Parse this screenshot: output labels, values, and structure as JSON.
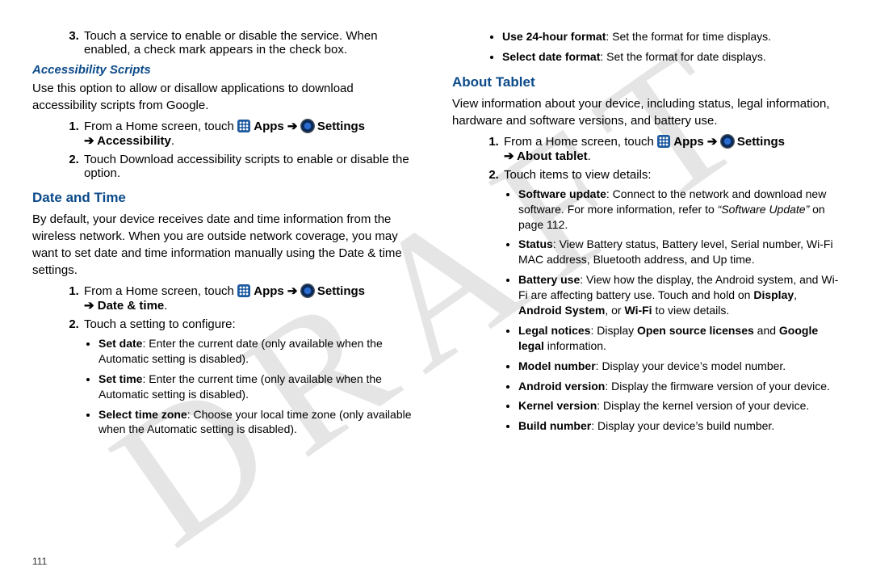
{
  "watermark": "DRAFT",
  "pagenum": "111",
  "left": {
    "step3": "Touch a service to enable or disable the service. When enabled, a check mark appears in the check box.",
    "accScripts": {
      "heading": "Accessibility Scripts",
      "intro": "Use this option to allow or disallow applications to download accessibility scripts from Google.",
      "s1_a": "From a Home screen, touch ",
      "s1_apps": " Apps ",
      "s1_arrow": "➔",
      "s1_settings": " Settings ",
      "s1_b": "➔ Accessibility",
      "s1_end": ".",
      "s2": "Touch Download accessibility scripts to enable or disable the option."
    },
    "dateTime": {
      "heading": "Date and Time",
      "intro": "By default, your device receives date and time information from the wireless network. When you are outside network coverage, you may want to set date and time information manually using the Date & time settings.",
      "s1_a": "From a Home screen, touch ",
      "s1_apps": " Apps ",
      "s1_arrow": "➔",
      "s1_settings": " Settings ",
      "s1_b": "➔ Date & time",
      "s1_end": ".",
      "s2": "Touch a setting to configure:",
      "bul": [
        {
          "b": "Set date",
          "t": ": Enter the current date (only available when the Automatic setting is disabled)."
        },
        {
          "b": "Set time",
          "t": ": Enter the current time (only available when the Automatic setting is disabled)."
        },
        {
          "b": "Select time zone",
          "t": ": Choose your local time zone (only available when the Automatic setting is disabled)."
        }
      ]
    }
  },
  "right": {
    "topBul": [
      {
        "b": "Use 24-hour format",
        "t": ": Set the format for time displays."
      },
      {
        "b": "Select date format",
        "t": ": Set the format for date displays."
      }
    ],
    "about": {
      "heading": "About Tablet",
      "intro": "View information about your device, including status, legal information, hardware and software versions, and battery use.",
      "s1_a": "From a Home screen, touch ",
      "s1_apps": " Apps ",
      "s1_arrow": "➔",
      "s1_settings": " Settings ",
      "s1_b": "➔ About tablet",
      "s1_end": ".",
      "s2": "Touch items to view details:",
      "bul": [
        {
          "b": "Software update",
          "t": ": Connect to the network and download new software.  For more information, refer to ",
          "ref": "“Software Update”",
          "tail": "  on page 112."
        },
        {
          "b": "Status",
          "t": ": View Battery status, Battery level, Serial number, Wi-Fi MAC address, Bluetooth address, and Up time."
        },
        {
          "b": "Battery use",
          "t": ": View how the display, the Android system, and Wi-Fi are affecting battery use.  Touch and hold on ",
          "mid_b1": "Display",
          "mid_t1": ", ",
          "mid_b2": "Android System",
          "mid_t2": ", or ",
          "mid_b3": "Wi-Fi",
          "tail": " to view details."
        },
        {
          "b": "Legal notices",
          "t": ": Display ",
          "mid_b1": "Open source licenses",
          "mid_t1": " and ",
          "mid_b2": "Google legal",
          "tail": " information."
        },
        {
          "b": "Model number",
          "t": ": Display your device’s model number."
        },
        {
          "b": "Android version",
          "t": ": Display the firmware version of your device."
        },
        {
          "b": "Kernel version",
          "t": ": Display the kernel version of your device."
        },
        {
          "b": "Build number",
          "t": ": Display your device’s build number."
        }
      ]
    }
  }
}
